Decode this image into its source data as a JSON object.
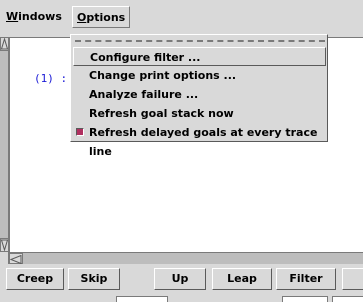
{
  "menubar": {
    "windows_prefix": "W",
    "windows_rest": "indows",
    "options_prefix": "O",
    "options_rest": "ptions"
  },
  "trace": {
    "line": "(1) :"
  },
  "options_menu": {
    "items": [
      {
        "label": "Configure filter ..."
      },
      {
        "label": "Change print options ..."
      },
      {
        "label": "Analyze failure ..."
      },
      {
        "label": "Refresh goal stack now"
      },
      {
        "label": "Refresh delayed goals at every trace line",
        "checked": true,
        "check_color": "#b03060"
      }
    ]
  },
  "buttons": {
    "creep": "Creep",
    "skip": "Skip",
    "up": "Up",
    "leap": "Leap",
    "filter": "Filter"
  },
  "colors": {
    "background": "#d9d9d9",
    "trace_text": "#1a1ad6"
  }
}
